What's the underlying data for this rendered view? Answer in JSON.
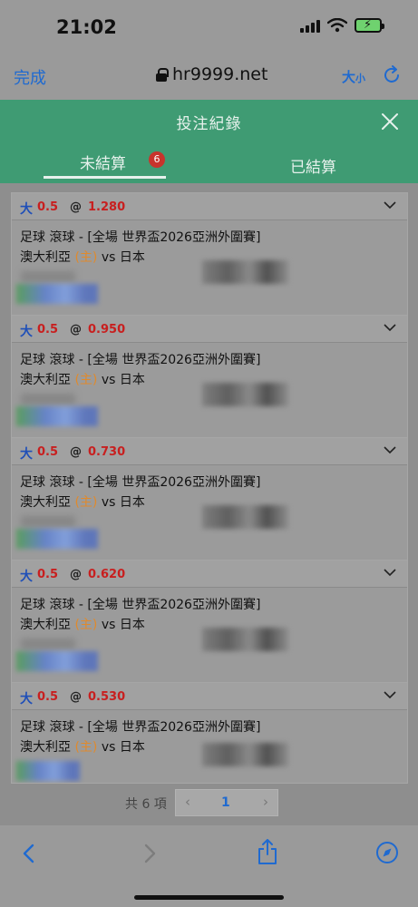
{
  "status": {
    "time": "21:02"
  },
  "browser": {
    "done_label": "完成",
    "url": "hr9999.net",
    "text_size_label": "大",
    "text_size_small": "小"
  },
  "modal": {
    "title": "投注紀錄"
  },
  "tabs": [
    {
      "label": "未結算",
      "badge": "6",
      "active": true
    },
    {
      "label": "已結算",
      "active": false
    }
  ],
  "bets": [
    {
      "type": "大",
      "line": "0.5",
      "at": "@",
      "odds": "1.280",
      "event": "足球 滾球 - [全場 世界盃2026亞洲外圍賽]",
      "home": "澳大利亞",
      "home_tag": "(主)",
      "vs": "vs",
      "away": "日本"
    },
    {
      "type": "大",
      "line": "0.5",
      "at": "@",
      "odds": "0.950",
      "event": "足球 滾球 - [全場 世界盃2026亞洲外圍賽]",
      "home": "澳大利亞",
      "home_tag": "(主)",
      "vs": "vs",
      "away": "日本"
    },
    {
      "type": "大",
      "line": "0.5",
      "at": "@",
      "odds": "0.730",
      "event": "足球 滾球 - [全場 世界盃2026亞洲外圍賽]",
      "home": "澳大利亞",
      "home_tag": "(主)",
      "vs": "vs",
      "away": "日本"
    },
    {
      "type": "大",
      "line": "0.5",
      "at": "@",
      "odds": "0.620",
      "event": "足球 滾球 - [全場 世界盃2026亞洲外圍賽]",
      "home": "澳大利亞",
      "home_tag": "(主)",
      "vs": "vs",
      "away": "日本"
    },
    {
      "type": "大",
      "line": "0.5",
      "at": "@",
      "odds": "0.530",
      "event": "足球 滾球 - [全場 世界盃2026亞洲外圍賽]",
      "home": "澳大利亞",
      "home_tag": "(主)",
      "vs": "vs",
      "away": "日本"
    }
  ],
  "pagination": {
    "total": "共 6 項",
    "prev": "‹",
    "page": "1",
    "next": "›"
  },
  "colors": {
    "header_green": "#3f9b73",
    "accent_blue": "#1f6ad0",
    "odds_red": "#c81f1f",
    "badge_red": "#c8342c",
    "home_orange": "#e08a2c"
  }
}
